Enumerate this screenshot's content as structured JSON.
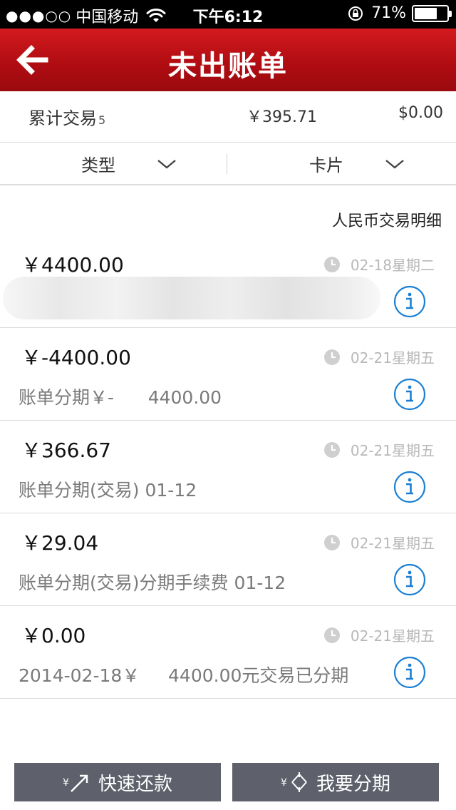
{
  "status_bar": {
    "signal": "●●●○○",
    "carrier": "中国移动",
    "time": "下午6:12",
    "battery": "71%",
    "battery_level": 0.71
  },
  "nav": {
    "title": "未出账单",
    "back_icon": "arrow-left-icon"
  },
  "summary": {
    "label": "累计交易",
    "count": "5",
    "rmb_total": "￥395.71",
    "usd_total": "$0.00"
  },
  "filters": {
    "type_label": "类型",
    "card_label": "卡片"
  },
  "list_header": "人民币交易明细",
  "transactions": [
    {
      "amount": "￥4400.00",
      "date": "02-18星期二",
      "desc": ""
    },
    {
      "amount": "￥-4400.00",
      "date": "02-21星期五",
      "desc": "账单分期￥-      4400.00"
    },
    {
      "amount": "￥366.67",
      "date": "02-21星期五",
      "desc": "账单分期(交易) 01-12"
    },
    {
      "amount": "￥29.04",
      "date": "02-21星期五",
      "desc": "账单分期(交易)分期手续费 01-12"
    },
    {
      "amount": "￥0.00",
      "date": "02-21星期五",
      "desc": "2014-02-18￥     4400.00元交易已分期"
    }
  ],
  "buttons": {
    "repay_label": "快速还款",
    "installment_label": "我要分期"
  },
  "colors": {
    "nav_red": "#b10d12",
    "button_gray": "#5e616c",
    "info_blue": "#1a7fd4"
  }
}
